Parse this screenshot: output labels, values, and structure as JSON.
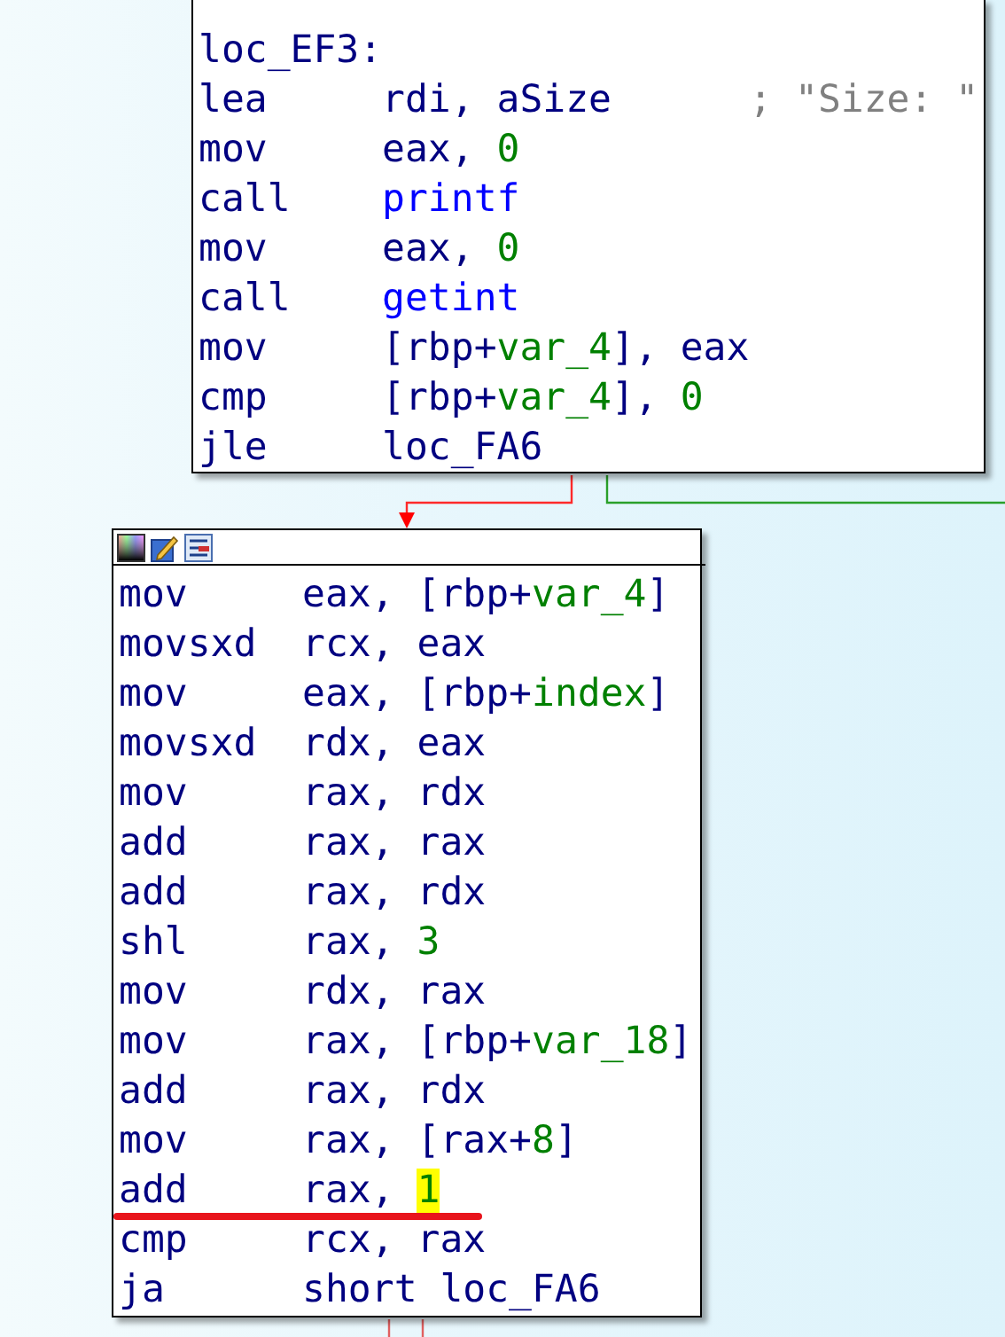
{
  "nodes": [
    {
      "toolbar": false,
      "lines": [
        {
          "kind": "label",
          "text": "loc_EF3:"
        },
        {
          "kind": "insn",
          "mnemonic": "lea",
          "underlined": false,
          "operands": [
            {
              "kind": "plain",
              "text": "rdi, aSize",
              "highlighted": false
            }
          ],
          "comment": "; \"Size: \""
        },
        {
          "kind": "insn",
          "mnemonic": "mov",
          "underlined": false,
          "operands": [
            {
              "kind": "plain",
              "text": "eax, ",
              "highlighted": false
            },
            {
              "kind": "num",
              "text": "0",
              "highlighted": false
            }
          ]
        },
        {
          "kind": "insn",
          "mnemonic": "call",
          "underlined": false,
          "operands": [
            {
              "kind": "func",
              "text": "printf",
              "highlighted": false
            }
          ]
        },
        {
          "kind": "insn",
          "mnemonic": "mov",
          "underlined": false,
          "operands": [
            {
              "kind": "plain",
              "text": "eax, ",
              "highlighted": false
            },
            {
              "kind": "num",
              "text": "0",
              "highlighted": false
            }
          ]
        },
        {
          "kind": "insn",
          "mnemonic": "call",
          "underlined": false,
          "operands": [
            {
              "kind": "func",
              "text": "getint",
              "highlighted": false
            }
          ]
        },
        {
          "kind": "insn",
          "mnemonic": "mov",
          "underlined": false,
          "operands": [
            {
              "kind": "plain",
              "text": "[rbp+",
              "highlighted": false
            },
            {
              "kind": "var",
              "text": "var_4",
              "highlighted": false
            },
            {
              "kind": "plain",
              "text": "], eax",
              "highlighted": false
            }
          ]
        },
        {
          "kind": "insn",
          "mnemonic": "cmp",
          "underlined": false,
          "operands": [
            {
              "kind": "plain",
              "text": "[rbp+",
              "highlighted": false
            },
            {
              "kind": "var",
              "text": "var_4",
              "highlighted": false
            },
            {
              "kind": "plain",
              "text": "], ",
              "highlighted": false
            },
            {
              "kind": "num",
              "text": "0",
              "highlighted": false
            }
          ]
        },
        {
          "kind": "insn",
          "mnemonic": "jle",
          "underlined": false,
          "operands": [
            {
              "kind": "plain",
              "text": "loc_FA6",
              "highlighted": false
            }
          ]
        }
      ]
    },
    {
      "toolbar": true,
      "lines": [
        {
          "kind": "insn",
          "mnemonic": "mov",
          "underlined": false,
          "operands": [
            {
              "kind": "plain",
              "text": "eax, [rbp+",
              "highlighted": false
            },
            {
              "kind": "var",
              "text": "var_4",
              "highlighted": false
            },
            {
              "kind": "plain",
              "text": "]",
              "highlighted": false
            }
          ]
        },
        {
          "kind": "insn",
          "mnemonic": "movsxd",
          "underlined": false,
          "operands": [
            {
              "kind": "plain",
              "text": "rcx, eax",
              "highlighted": false
            }
          ]
        },
        {
          "kind": "insn",
          "mnemonic": "mov",
          "underlined": false,
          "operands": [
            {
              "kind": "plain",
              "text": "eax, [rbp+",
              "highlighted": false
            },
            {
              "kind": "var",
              "text": "index",
              "highlighted": false
            },
            {
              "kind": "plain",
              "text": "]",
              "highlighted": false
            }
          ]
        },
        {
          "kind": "insn",
          "mnemonic": "movsxd",
          "underlined": false,
          "operands": [
            {
              "kind": "plain",
              "text": "rdx, eax",
              "highlighted": false
            }
          ]
        },
        {
          "kind": "insn",
          "mnemonic": "mov",
          "underlined": false,
          "operands": [
            {
              "kind": "plain",
              "text": "rax, rdx",
              "highlighted": false
            }
          ]
        },
        {
          "kind": "insn",
          "mnemonic": "add",
          "underlined": false,
          "operands": [
            {
              "kind": "plain",
              "text": "rax, rax",
              "highlighted": false
            }
          ]
        },
        {
          "kind": "insn",
          "mnemonic": "add",
          "underlined": false,
          "operands": [
            {
              "kind": "plain",
              "text": "rax, rdx",
              "highlighted": false
            }
          ]
        },
        {
          "kind": "insn",
          "mnemonic": "shl",
          "underlined": false,
          "operands": [
            {
              "kind": "plain",
              "text": "rax, ",
              "highlighted": false
            },
            {
              "kind": "num",
              "text": "3",
              "highlighted": false
            }
          ]
        },
        {
          "kind": "insn",
          "mnemonic": "mov",
          "underlined": false,
          "operands": [
            {
              "kind": "plain",
              "text": "rdx, rax",
              "highlighted": false
            }
          ]
        },
        {
          "kind": "insn",
          "mnemonic": "mov",
          "underlined": false,
          "operands": [
            {
              "kind": "plain",
              "text": "rax, [rbp+",
              "highlighted": false
            },
            {
              "kind": "var",
              "text": "var_18",
              "highlighted": false
            },
            {
              "kind": "plain",
              "text": "]",
              "highlighted": false
            }
          ]
        },
        {
          "kind": "insn",
          "mnemonic": "add",
          "underlined": false,
          "operands": [
            {
              "kind": "plain",
              "text": "rax, rdx",
              "highlighted": false
            }
          ]
        },
        {
          "kind": "insn",
          "mnemonic": "mov",
          "underlined": false,
          "operands": [
            {
              "kind": "plain",
              "text": "rax, [rax+",
              "highlighted": false
            },
            {
              "kind": "num",
              "text": "8",
              "highlighted": false
            },
            {
              "kind": "plain",
              "text": "]",
              "highlighted": false
            }
          ]
        },
        {
          "kind": "insn",
          "mnemonic": "add",
          "underlined": true,
          "operands": [
            {
              "kind": "plain",
              "text": "rax, ",
              "highlighted": false
            },
            {
              "kind": "num",
              "text": "1",
              "highlighted": true
            }
          ]
        },
        {
          "kind": "insn",
          "mnemonic": "cmp",
          "underlined": false,
          "operands": [
            {
              "kind": "plain",
              "text": "rcx, rax",
              "highlighted": false
            }
          ]
        },
        {
          "kind": "insn",
          "mnemonic": "ja",
          "underlined": false,
          "operands": [
            {
              "kind": "plain",
              "text": "short loc_FA6",
              "highlighted": false
            }
          ]
        }
      ]
    }
  ]
}
